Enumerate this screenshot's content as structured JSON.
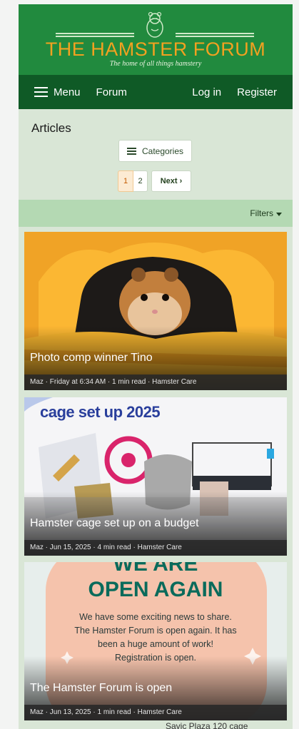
{
  "header": {
    "site_title": "THE HAMSTER FORUM",
    "tagline": "The home of all things hamstery"
  },
  "nav": {
    "menu_label": "Menu",
    "forum_label": "Forum",
    "login_label": "Log in",
    "register_label": "Register"
  },
  "page": {
    "title": "Articles",
    "categories_label": "Categories",
    "pages": [
      "1",
      "2"
    ],
    "next_label": "Next ›",
    "filters_label": "Filters"
  },
  "articles": [
    {
      "title": "Photo comp winner Tino",
      "meta": "Maz · Friday at 6:34 AM · 1 min read · Hamster Care"
    },
    {
      "title": "Hamster cage set up on a budget",
      "meta": "Maz · Jun 15, 2025 · 4 min read · Hamster Care",
      "image_text": "cage set up 2025"
    },
    {
      "title": "The Hamster Forum is open",
      "meta": "Maz · Jun 13, 2025 · 1 min read · Hamster Care",
      "image_heading_top": "WE ARE",
      "image_heading": "OPEN AGAIN",
      "image_body": [
        "We have some exciting news to share.",
        "The Hamster Forum is open again. It has",
        "been a huge amount of work!",
        "Registration is open."
      ]
    }
  ],
  "below_fold_text": "Savic Plaza 120 cage",
  "colors": {
    "header_green": "#218a3e",
    "nav_green": "#0f5a26",
    "title_orange": "#f2a120",
    "page_bg": "#d9e6d6",
    "filters_bg": "#b4d9b3"
  }
}
